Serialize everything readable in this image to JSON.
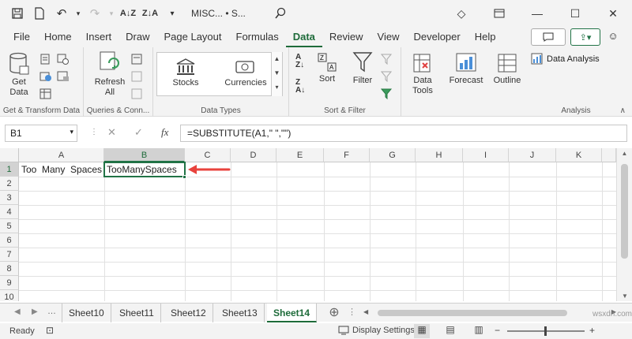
{
  "titlebar": {
    "title": "MISC... • S..."
  },
  "menus": [
    "File",
    "Home",
    "Insert",
    "Draw",
    "Page Layout",
    "Formulas",
    "Data",
    "Review",
    "View",
    "Developer",
    "Help"
  ],
  "ribbon": {
    "get_data": "Get Data",
    "refresh_all": "Refresh All",
    "stocks": "Stocks",
    "currencies": "Currencies",
    "sort": "Sort",
    "filter": "Filter",
    "data_tools": "Data Tools",
    "forecast": "Forecast",
    "outline": "Outline",
    "data_analysis": "Data Analysis",
    "groups": {
      "get_transform": "Get & Transform Data",
      "queries": "Queries & Conn...",
      "data_types": "Data Types",
      "sort_filter": "Sort & Filter",
      "analysis": "Analysis"
    }
  },
  "formula_bar": {
    "name_box": "B1",
    "fx": "fx",
    "formula": "=SUBSTITUTE(A1,\" \",\"\")"
  },
  "columns": [
    "A",
    "B",
    "C",
    "D",
    "E",
    "F",
    "G",
    "H",
    "I",
    "J",
    "K"
  ],
  "rows": [
    "1",
    "2",
    "3",
    "4",
    "5",
    "6",
    "7",
    "8",
    "9",
    "10"
  ],
  "cells": {
    "A1": "Too  Many  Spaces",
    "B1": "TooManySpaces"
  },
  "sheet_tabs": [
    "Sheet10",
    "Sheet11",
    "Sheet12",
    "Sheet13",
    "Sheet14"
  ],
  "active_sheet": "Sheet14",
  "status": {
    "ready": "Ready",
    "display_settings": "Display Settings"
  },
  "watermark": "wsxdn.com",
  "colors": {
    "accent": "#217346",
    "arrow": "#e8423c"
  }
}
